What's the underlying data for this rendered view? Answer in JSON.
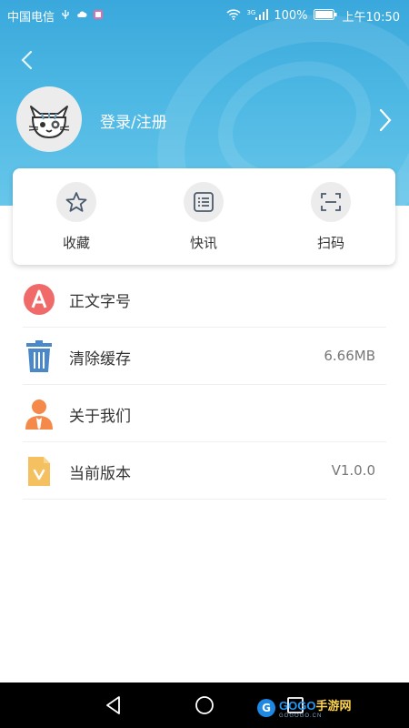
{
  "status_bar": {
    "carrier": "中国电信",
    "network": "3G",
    "battery": "100%",
    "time": "上午10:50"
  },
  "header": {
    "login_label": "登录/注册"
  },
  "quick_actions": [
    {
      "label": "收藏",
      "icon": "star-icon"
    },
    {
      "label": "快讯",
      "icon": "news-list-icon"
    },
    {
      "label": "扫码",
      "icon": "scan-icon"
    }
  ],
  "settings": [
    {
      "label": "正文字号",
      "value": "",
      "icon": "font-size-icon"
    },
    {
      "label": "清除缓存",
      "value": "6.66MB",
      "icon": "trash-icon"
    },
    {
      "label": "关于我们",
      "value": "",
      "icon": "person-icon"
    },
    {
      "label": "当前版本",
      "value": "V1.0.0",
      "icon": "version-doc-icon"
    }
  ],
  "watermark": {
    "logo_letter": "G",
    "brand_main": "GOGO",
    "brand_suffix": "手游网",
    "brand_url": "GOGOGO.CN"
  },
  "colors": {
    "header_blue": "#3aa8dc",
    "font_icon_red": "#f06a6a",
    "trash_blue": "#4a88c9",
    "person_orange": "#f5894a",
    "doc_yellow": "#f5c060"
  }
}
